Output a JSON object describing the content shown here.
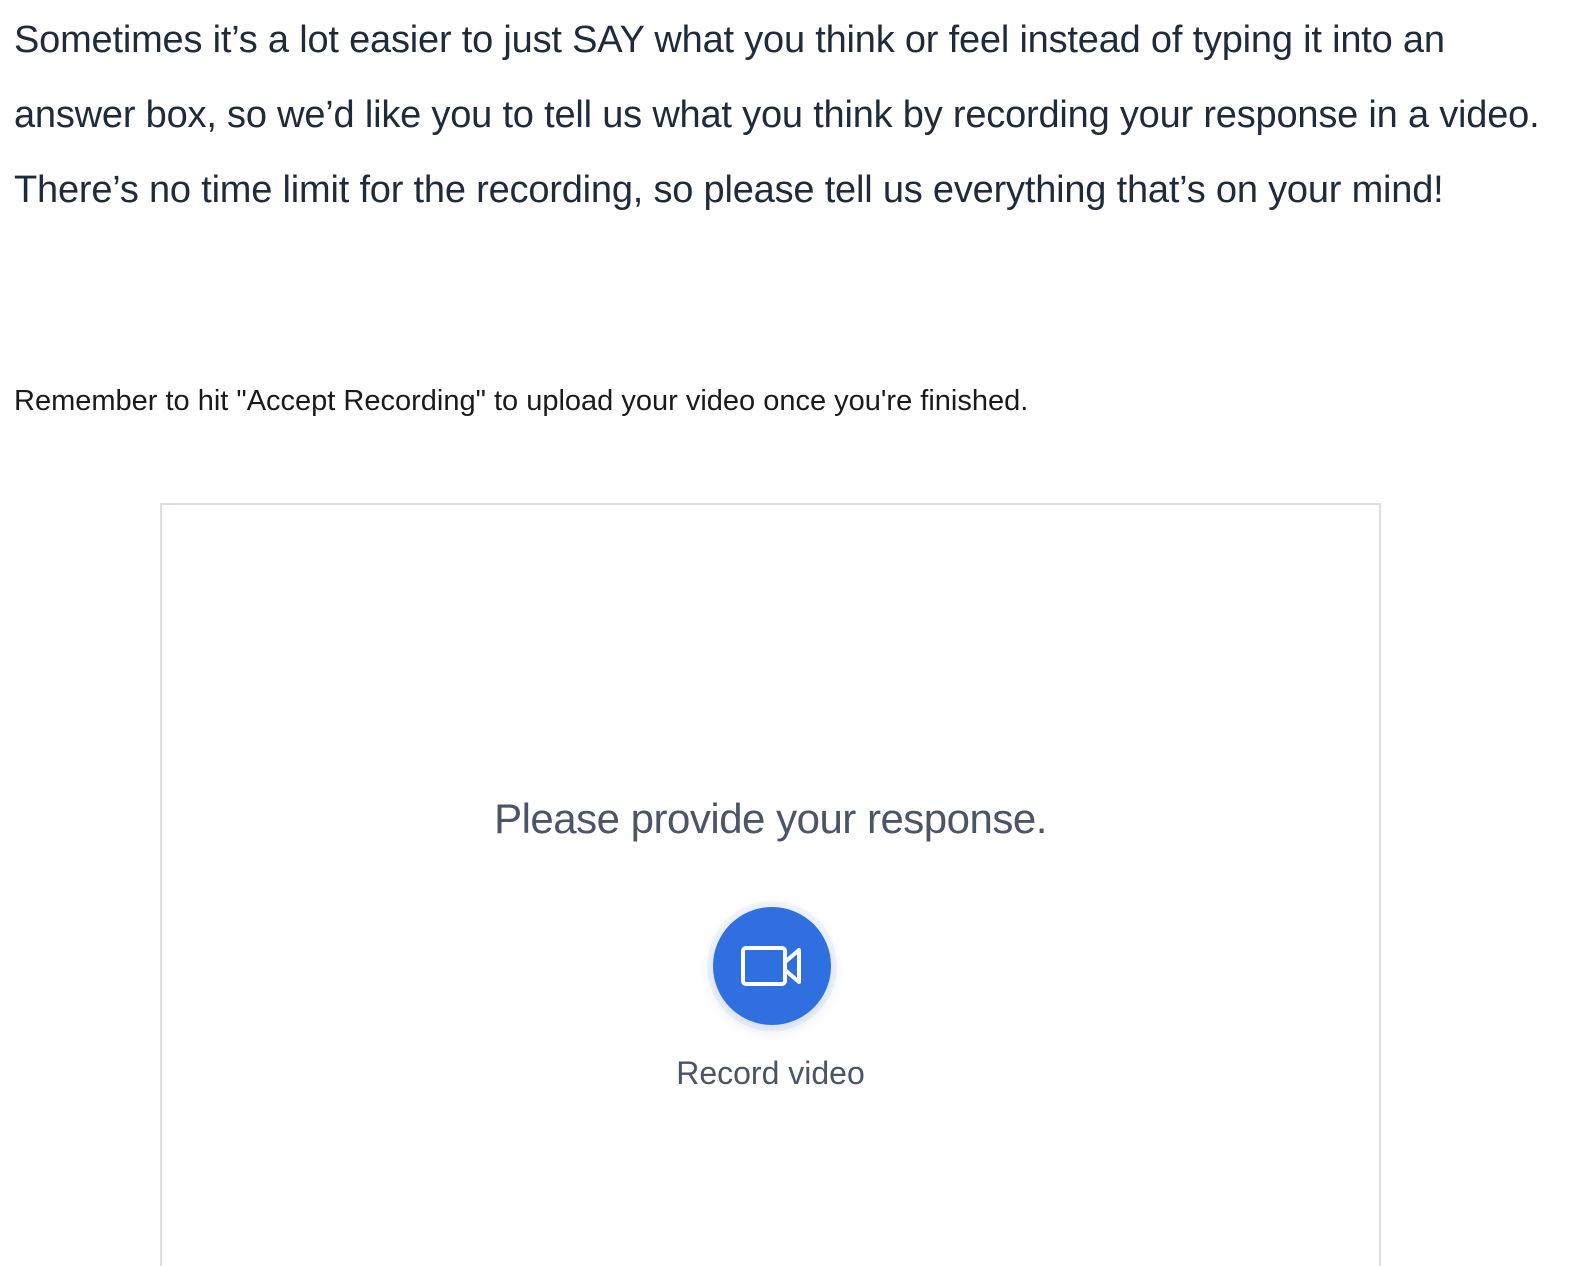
{
  "question": {
    "text": "Sometimes it’s a lot easier to just SAY what you think or feel instead of typing it into an answer box, so we’d like you to tell us what you think by recording your response in a video. There’s no time limit for the recording, so please tell us everything that’s on your mind!"
  },
  "instruction": {
    "text": "Remember to hit \"Accept Recording\" to upload your video once you're finished."
  },
  "recorder": {
    "prompt": "Please provide your response.",
    "record_label": "Record video",
    "record_icon": "video-camera-icon",
    "accent_color": "#2f6fe0"
  }
}
